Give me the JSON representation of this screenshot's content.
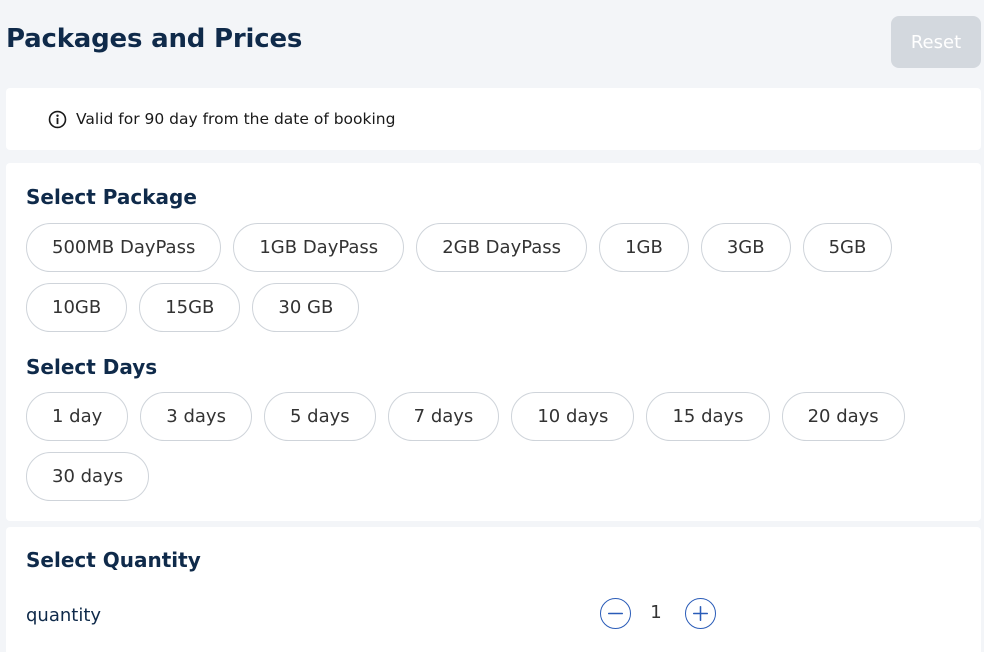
{
  "header": {
    "title": "Packages and Prices",
    "reset_label": "Reset"
  },
  "info": {
    "icon": "info-icon",
    "text": "Valid for 90 day from the date of booking"
  },
  "packages": {
    "heading": "Select Package",
    "options": [
      "500MB DayPass",
      "1GB DayPass",
      "2GB DayPass",
      "1GB",
      "3GB",
      "5GB",
      "10GB",
      "15GB",
      "30 GB"
    ]
  },
  "days": {
    "heading": "Select Days",
    "options": [
      "1 day",
      "3 days",
      "5 days",
      "7 days",
      "10 days",
      "15 days",
      "20 days",
      "30 days"
    ]
  },
  "quantity": {
    "heading": "Select Quantity",
    "label": "quantity",
    "value": "1",
    "decrement_icon": "minus-icon",
    "increment_icon": "plus-icon"
  },
  "colors": {
    "title": "#0f2a4a",
    "accent": "#2a5cb8",
    "chip_border": "#cfd4da",
    "reset_disabled_bg": "#d3d8de"
  }
}
